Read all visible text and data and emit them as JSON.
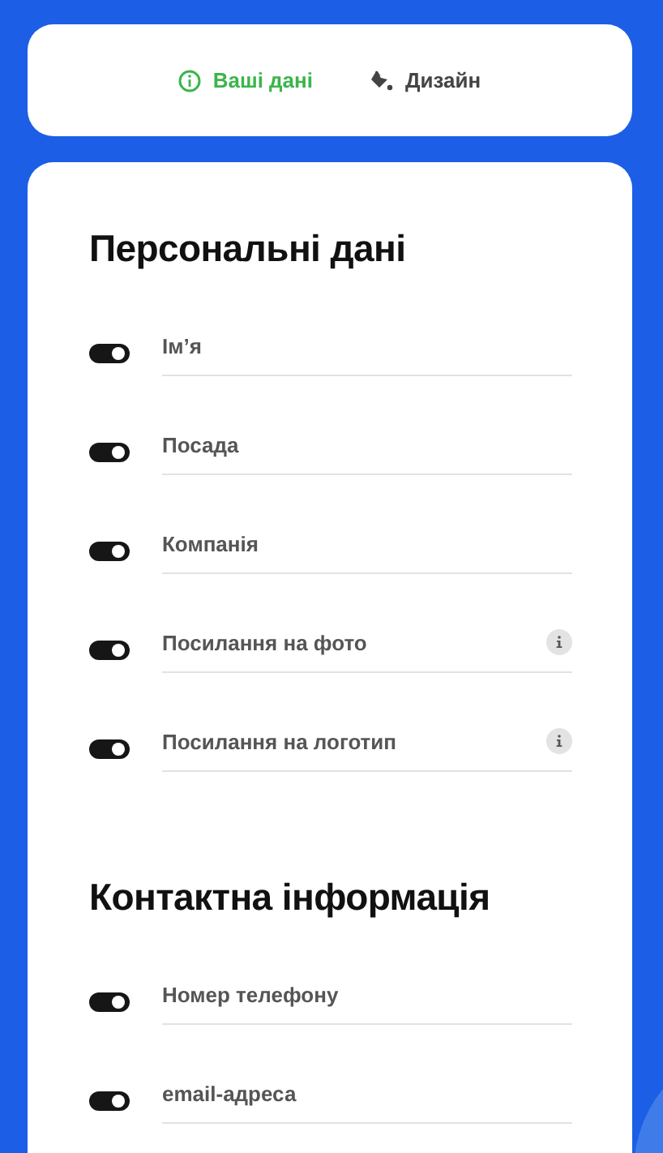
{
  "tabs": [
    {
      "label": "Ваші дані",
      "kind": "info",
      "selected": true
    },
    {
      "label": "Дизайн",
      "kind": "bucket",
      "selected": false
    }
  ],
  "sections": [
    {
      "title": "Персональні дані",
      "fields": [
        {
          "placeholder": "Ім’я",
          "on": true,
          "info": false
        },
        {
          "placeholder": "Посада",
          "on": true,
          "info": false
        },
        {
          "placeholder": "Компанія",
          "on": true,
          "info": false
        },
        {
          "placeholder": "Посилання на фото",
          "on": true,
          "info": true
        },
        {
          "placeholder": "Посилання на логотип",
          "on": true,
          "info": true
        }
      ]
    },
    {
      "title": "Контактна інформація",
      "fields": [
        {
          "placeholder": "Номер телефону",
          "on": true,
          "info": false
        },
        {
          "placeholder": "email-адреса",
          "on": true,
          "info": false
        }
      ]
    }
  ]
}
